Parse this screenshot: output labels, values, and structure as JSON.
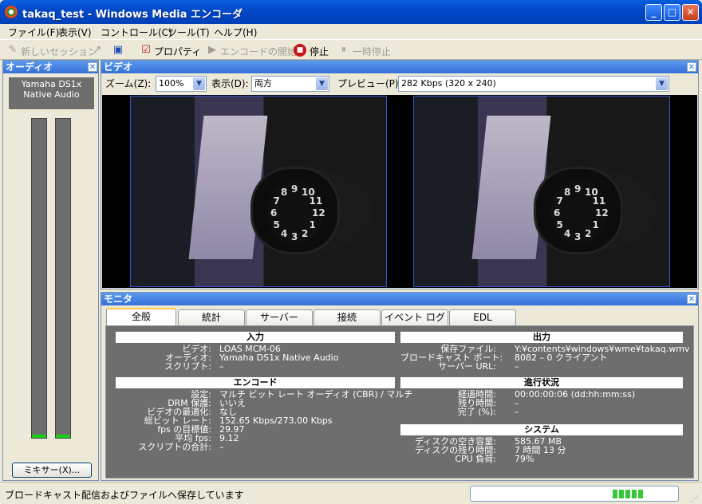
{
  "window": {
    "title": "takaq_test - Windows Media エンコーダ",
    "minimize_icon": "minimize-icon",
    "maximize_icon": "maximize-icon",
    "close_icon": "close-icon"
  },
  "menu": [
    "ファイル(F)",
    "表示(V)",
    "コントロール(C)",
    "ツール(T)",
    "ヘルプ(H)"
  ],
  "toolbar": {
    "new_session": "新しいセッション",
    "properties": "プロパティ",
    "start_encoding": "エンコードの開始",
    "stop": "停止",
    "pause": "一時停止"
  },
  "audio_panel": {
    "title": "オーディオ",
    "device": "Yamaha DS1x Native Audio",
    "mixer_button": "ミキサー(X)...",
    "meter_left_level": 0.01,
    "meter_right_level": 0.01,
    "meter_color": "#17D017"
  },
  "video_panel": {
    "title": "ビデオ",
    "zoom_label": "ズーム(Z):",
    "zoom_value": "100%",
    "view_label": "表示(D):",
    "view_value": "両方",
    "preview_label": "プレビュー(P):",
    "preview_value": "282 Kbps (320 x 240)"
  },
  "monitor_panel": {
    "title": "モニタ",
    "tabs": [
      "全般",
      "統計",
      "サーバー",
      "接続",
      "イベント ログ",
      "EDL"
    ],
    "input": {
      "heading": "入力",
      "rows": [
        [
          "ビデオ:",
          "LOAS MCM-06"
        ],
        [
          "オーディオ:",
          "Yamaha DS1x Native Audio"
        ],
        [
          "スクリプト:",
          "–"
        ]
      ]
    },
    "output": {
      "heading": "出力",
      "rows": [
        [
          "保存ファイル:",
          "Y:¥contents¥windows¥wme¥takaq.wmv"
        ],
        [
          "ブロードキャスト ポート:",
          "8082 – 0 クライアント"
        ],
        [
          "サーバー URL:",
          "–"
        ]
      ]
    },
    "encode": {
      "heading": "エンコード",
      "rows": [
        [
          "設定:",
          "マルチ ビット レート オーディオ (CBR) / マルチ"
        ],
        [
          "DRM 保護:",
          "いいえ"
        ],
        [
          "ビデオの最適化:",
          "なし"
        ],
        [
          "総ビット レート:",
          "152.65 Kbps/273.00 Kbps"
        ],
        [
          "fps の目標値:",
          "29.97"
        ],
        [
          "平均 fps:",
          "9.12"
        ],
        [
          "スクリプトの合計:",
          "–"
        ]
      ]
    },
    "progress": {
      "heading": "進行状況",
      "rows": [
        [
          "経過時間:",
          "00:00:00:06 (dd:hh:mm:ss)"
        ],
        [
          "残り時間:",
          "–"
        ],
        [
          "完了 (%):",
          "–"
        ]
      ]
    },
    "system": {
      "heading": "システム",
      "rows": [
        [
          "ディスクの空き容量:",
          "585.67 MB"
        ],
        [
          "ディスクの残り時間:",
          "7 時間 13 分"
        ],
        [
          "CPU 負荷:",
          "79%"
        ]
      ]
    }
  },
  "statusbar": {
    "text": "ブロードキャスト配信およびファイルへ保存しています",
    "progress_blocks": 5
  }
}
